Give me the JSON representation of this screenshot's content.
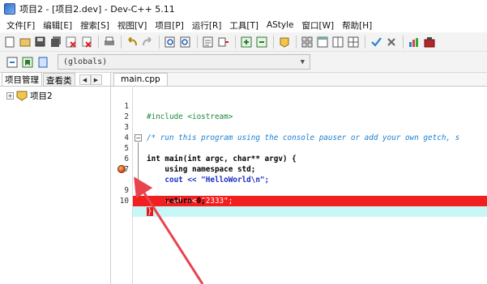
{
  "window": {
    "title": "项目2 - [项目2.dev] - Dev-C++ 5.11"
  },
  "menu": [
    {
      "label": "文件[F]"
    },
    {
      "label": "编辑[E]"
    },
    {
      "label": "搜索[S]"
    },
    {
      "label": "视图[V]"
    },
    {
      "label": "项目[P]"
    },
    {
      "label": "运行[R]"
    },
    {
      "label": "工具[T]"
    },
    {
      "label": "AStyle"
    },
    {
      "label": "窗口[W]"
    },
    {
      "label": "帮助[H]"
    }
  ],
  "toolbar2": {
    "scope_value": "(globals)"
  },
  "left_panel": {
    "tabs": [
      {
        "label": "项目管理"
      },
      {
        "label": "查看类"
      }
    ],
    "tree_root": "项目2"
  },
  "editor": {
    "active_tab": "main.cpp",
    "lines": [
      {
        "n": "1",
        "text": "#include <iostream>"
      },
      {
        "n": "2",
        "text": ""
      },
      {
        "n": "3",
        "text": "/* run this program using the console pauser or add your own getch, s"
      },
      {
        "n": "4",
        "text": ""
      },
      {
        "n": "5",
        "text": "int main(int argc, char** argv) {"
      },
      {
        "n": "6",
        "text": "    using namespace std;"
      },
      {
        "n": "7",
        "text": "    cout << \"HelloWorld\\n\";"
      },
      {
        "n": "8",
        "text": "    cout << \"2333\";"
      },
      {
        "n": "9",
        "text": "    return 0;"
      },
      {
        "n": "10",
        "text": "}"
      }
    ],
    "breakpoint_line": "8",
    "active_line": "10"
  },
  "colors": {
    "breakpoint_highlight": "#f21f1f",
    "active_line_highlight": "#c8f7f8",
    "annotation_arrow": "#e8434f",
    "comment": "#1a7fd1",
    "preprocessor": "#1a8a3a"
  }
}
